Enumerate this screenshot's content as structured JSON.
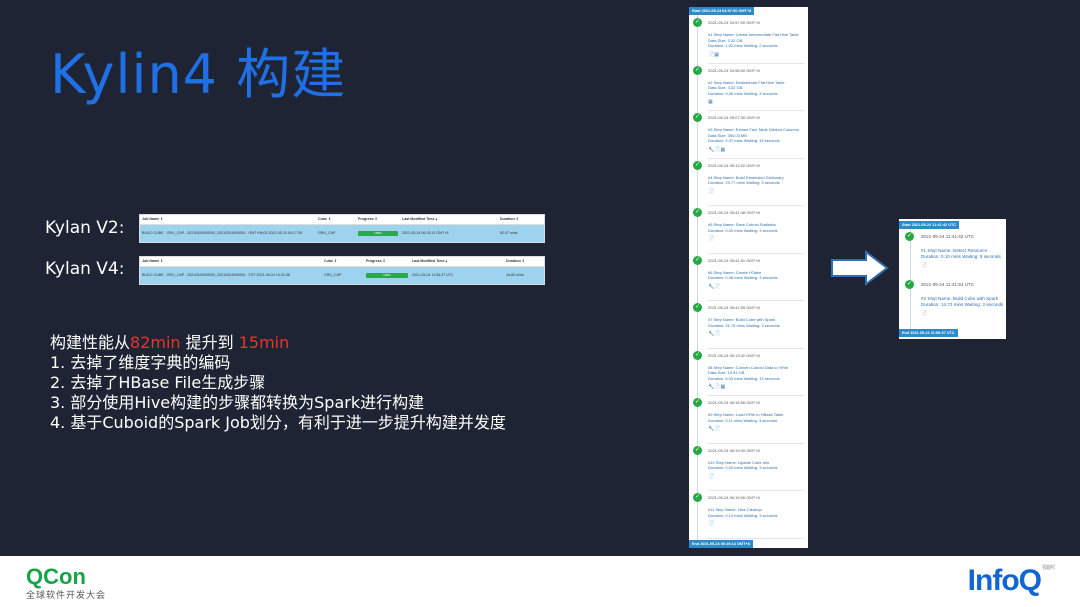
{
  "slide": {
    "title": "Kylin4 构建",
    "v2_label": "Kylan V2:",
    "v4_label": "Kylan V4:"
  },
  "table_v2": {
    "headers": [
      "Job Name ⇕",
      "Cube ⇕",
      "Progress ⇕",
      "Last Modified Time ▴",
      "Duration ⇕"
    ],
    "row": {
      "job_name": "BUILD CUBE - GRU_CAP - 20210524000000_20210524000000 - GMT+08:00 2021-05-24 00:17:38",
      "cube": "GRU_CAP",
      "progress": 100,
      "progress_label": "100%",
      "modified": "2021-05-24 06:15:13 GMT+8",
      "duration": "82.07 mins"
    }
  },
  "table_v4": {
    "headers": [
      "Job Name ⇕",
      "Cube ⇕",
      "Progress ⇕",
      "Last Modified Time ▴",
      "Duration ⇕"
    ],
    "row": {
      "job_name": "BUILD CUBE - GRU_CAP - 20210524000000_20210524000000 - CST 2021-05-24 19:31:58",
      "cube": "GRU_CAP",
      "progress": 100,
      "progress_label": "100%",
      "modified": "2021-05-24 11:56:37 UTC",
      "duration": "16.85 mins"
    }
  },
  "summary": {
    "lead_before": "构建性能从",
    "lead_from": "82min",
    "lead_mid": " 提升到 ",
    "lead_to": "15min",
    "items": [
      "1.  去掉了维度字典的编码",
      "2.  去掉了HBase File生成步骤",
      "3.  部分使用Hive构建的步骤都转换为Spark进行构建",
      "4.  基于Cuboid的Spark Job划分，有利于进一步提升构建并发度"
    ]
  },
  "v2_steps": {
    "start": "Start  2021-05-24 04:57:00 GMT+8",
    "end": "End  2021-05-24 06:19:13 GMT+8",
    "steps": [
      {
        "time": "2021-05-24 04:57:00 GMT+8",
        "name": "#1 Step Name: Create Intermediate Flat Hive Table",
        "size": "Data Size: 3.32 GB",
        "info": "Duration: 1.02 mins Waiting: 2 seconds",
        "icons": "📄▦"
      },
      {
        "time": "2021-05-24 04:58:00 GMT+8",
        "name": "#2 Step Name: Redistribute Flat Hive Table",
        "size": "Data Size: 3.32 GB",
        "info": "Duration: 9.46 mins Waiting: 3 seconds",
        "icons": "▦"
      },
      {
        "time": "2021-05-24 05:07:30 GMT+8",
        "name": "#3 Step Name: Extract Fact Table Distinct Columns",
        "size": "Data Size: 390.03 MB",
        "info": "Duration: 4.37 mins Waiting: 15 seconds",
        "icons": "🔧📄▦"
      },
      {
        "time": "2021-05-24 05:12:02 GMT+8",
        "name": "#4 Step Name: Build Dimension Dictionary",
        "size": "",
        "info": "Duration: 29.77 mins Waiting: 3 seconds",
        "icons": "📄"
      },
      {
        "time": "2021-05-24 05:41:48 GMT+8",
        "name": "#5 Step Name: Save Cuboid Statistics",
        "size": "",
        "info": "Duration: 0.00 mins Waiting: 3 seconds",
        "icons": "📄"
      },
      {
        "time": "2021-05-24 05:41:51 GMT+8",
        "name": "#6 Step Name: Create HTable",
        "size": "",
        "info": "Duration: 0.08 mins Waiting: 3 seconds",
        "icons": "🔧📄"
      },
      {
        "time": "2021-05-24 05:41:55 GMT+8",
        "name": "#7 Step Name: Build Cube with Spark",
        "size": "",
        "info": "Duration: 31.76 mins Waiting: 3 seconds",
        "icons": "🔧📄"
      },
      {
        "time": "2021-05-24 06:13:42 GMT+8",
        "name": "#8 Step Name: Convert Cuboid Data to HFile",
        "size": "Data Size: 15.81 GB",
        "info": "Duration: 5.03 mins Waiting: 13 seconds",
        "icons": "🔧📄▦"
      },
      {
        "time": "2021-05-24 06:18:56 GMT+8",
        "name": "#9 Step Name: Load HFile to HBase Table",
        "size": "",
        "info": "Duration: 0.11 mins Waiting: 3 seconds",
        "icons": "🔧📄"
      },
      {
        "time": "2021-05-24 06:19:00 GMT+8",
        "name": "#10 Step Name: Update Cube Info",
        "size": "",
        "info": "Duration: 0.00 mins Waiting: 3 seconds",
        "icons": "📄"
      },
      {
        "time": "2021-05-24 06:19:06 GMT+8",
        "name": "#11 Step Name: Hive Cleanup",
        "size": "",
        "info": "Duration: 0.10 mins Waiting: 3 seconds",
        "icons": "📄"
      }
    ]
  },
  "v4_steps": {
    "start": "Start  2021-05-24 11:41:42 UTC",
    "end": "End  2021-05-24 11:56:37 UTC",
    "steps": [
      {
        "time": "2021-05-24 11:41:42 UTC",
        "name": "#1 Step Name: Detect Resource",
        "info": "Duration: 0.10 mins Waiting: 5 seconds",
        "icons": "📄"
      },
      {
        "time": "2021-05-24 11:41:54 UTC",
        "name": "#2 Step Name: Build Cube with Spark",
        "info": "Duration: 14.73 mins Waiting: 3 seconds",
        "icons": "📄"
      }
    ]
  },
  "footer": {
    "qcon": "QCon",
    "qcon_sub": "全球软件开发大会",
    "infoq": "InfoQ",
    "infoq_sup": "极客邦"
  },
  "colors": {
    "accent": "#1f6fe5",
    "highlight": "#e8352b",
    "success": "#27a844",
    "row_highlight": "#9ed3ef"
  }
}
